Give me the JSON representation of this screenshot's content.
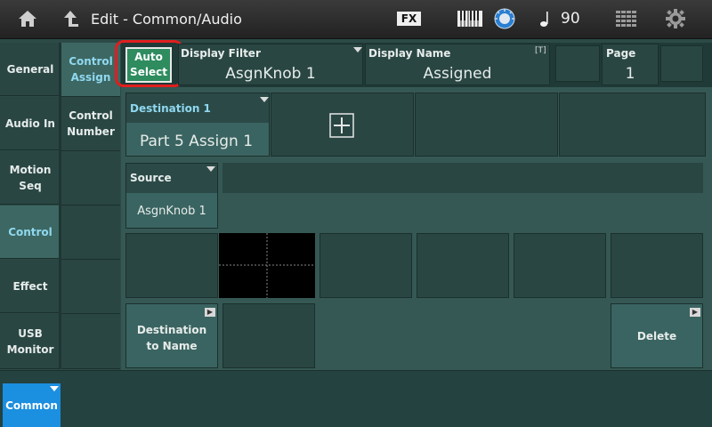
{
  "header": {
    "title": "Edit - Common/Audio",
    "fx_label": "FX",
    "tempo": "90",
    "icons": [
      "home-icon",
      "up-arrow-icon",
      "fx-icon",
      "keyboard-icon",
      "dial-icon",
      "note-icon",
      "grid-icon",
      "gear-icon"
    ]
  },
  "left_tabs": [
    "General",
    "Audio In",
    "Motion\nSeq",
    "Control",
    "Effect",
    "USB\nMonitor"
  ],
  "sub_tabs": [
    "Control\nAssign",
    "Control\nNumber"
  ],
  "auto_select": "Auto\nSelect",
  "display_filter": {
    "label": "Display Filter",
    "value": "AsgnKnob 1"
  },
  "display_name": {
    "label": "Display Name",
    "value": "Assigned",
    "badge": "[T]"
  },
  "page": {
    "label": "Page",
    "value": "1"
  },
  "destination": {
    "label": "Destination 1",
    "value": "Part 5 Assign 1"
  },
  "source": {
    "label": "Source",
    "value": "AsgnKnob 1"
  },
  "dest_to_name": "Destination\nto Name",
  "delete_label": "Delete",
  "bottom_tab": "Common",
  "colors": {
    "accent_blue": "#1b8fe0",
    "auto_select_green": "#2e8c5f",
    "highlight_red": "#e01e1e"
  }
}
